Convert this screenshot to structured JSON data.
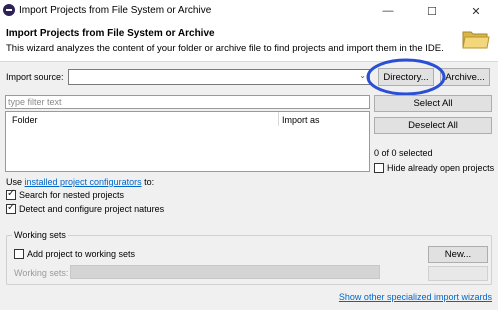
{
  "window": {
    "title": "Import Projects from File System or Archive",
    "minimize": "—",
    "maximize": "☐",
    "close": "✕"
  },
  "header": {
    "title": "Import Projects from File System or Archive",
    "description": "This wizard analyzes the content of your folder or archive file to find projects and import them in the IDE."
  },
  "import_source": {
    "label": "Import source:",
    "value": "",
    "directory_button": "Directory...",
    "archive_button": "Archive..."
  },
  "filter": {
    "placeholder": "type filter text"
  },
  "table": {
    "columns": [
      "Folder",
      "Import as"
    ]
  },
  "side": {
    "select_all": "Select All",
    "deselect_all": "Deselect All",
    "selected_count": "0 of 0 selected",
    "hide_open": "Hide already open projects"
  },
  "options": {
    "use_prefix": "Use ",
    "configurators_link": "installed project configurators",
    "use_suffix": " to:",
    "search_nested": "Search for nested projects",
    "detect_configure": "Detect and configure project natures"
  },
  "working_sets": {
    "group_label": "Working sets",
    "add_project": "Add project to working sets",
    "new_button": "New...",
    "sets_label": "Working sets:"
  },
  "footer": {
    "specialized_link": "Show other specialized import wizards"
  },
  "colors": {
    "highlight_circle": "#2a4fd6",
    "link": "#0066cc"
  }
}
